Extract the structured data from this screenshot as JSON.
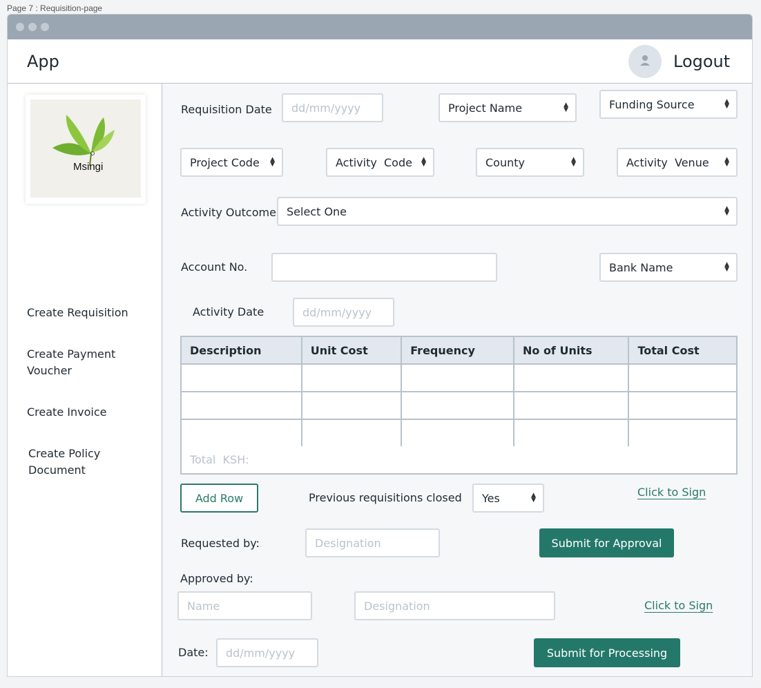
{
  "page_label": "Page 7 : Requisition-page",
  "header": {
    "app_title": "App",
    "logout_label": "Logout"
  },
  "sidebar": {
    "logo_text": "Msingi",
    "items": [
      {
        "label": "Create Requisition"
      },
      {
        "label": "Create Payment Voucher"
      },
      {
        "label": "Create Invoice"
      },
      {
        "label": "Create Policy Document"
      }
    ]
  },
  "form": {
    "requisition_date_label": "Requisition Date",
    "requisition_date_placeholder": "dd/mm/yyyy",
    "project_name": "Project Name",
    "funding_source": "Funding Source",
    "project_code": "Project Code",
    "activity_code": "Activity  Code",
    "county": "County",
    "activity_venue": "Activity  Venue",
    "activity_outcome_label": "Activity Outcome",
    "activity_outcome_value": "Select One",
    "account_no_label": "Account No.",
    "account_no_value": "",
    "bank_name": "Bank Name",
    "activity_date_label": "Activity Date",
    "activity_date_placeholder": "dd/mm/yyyy"
  },
  "table": {
    "headers": [
      "Description",
      "Unit Cost",
      "Frequency",
      "No of Units",
      "Total Cost"
    ],
    "rows": [
      [
        "",
        "",
        "",
        "",
        ""
      ],
      [
        "",
        "",
        "",
        "",
        ""
      ],
      [
        "",
        "",
        "",
        "",
        ""
      ]
    ],
    "total_label": "Total  KSH:"
  },
  "actions": {
    "add_row": "Add Row",
    "prev_closed_label": "Previous requisitions closed",
    "prev_closed_value": "Yes",
    "click_to_sign_1": "Click to Sign",
    "requested_by_label": "Requested by:",
    "requested_designation_placeholder": "Designation",
    "submit_approval": "Submit for Approval",
    "approved_by_label": "Approved by:",
    "approved_name_placeholder": "Name",
    "approved_designation_placeholder": "Designation",
    "click_to_sign_2": "Click to Sign",
    "date_label": "Date:",
    "date_placeholder": "dd/mm/yyyy",
    "submit_processing": "Submit for Processing"
  }
}
